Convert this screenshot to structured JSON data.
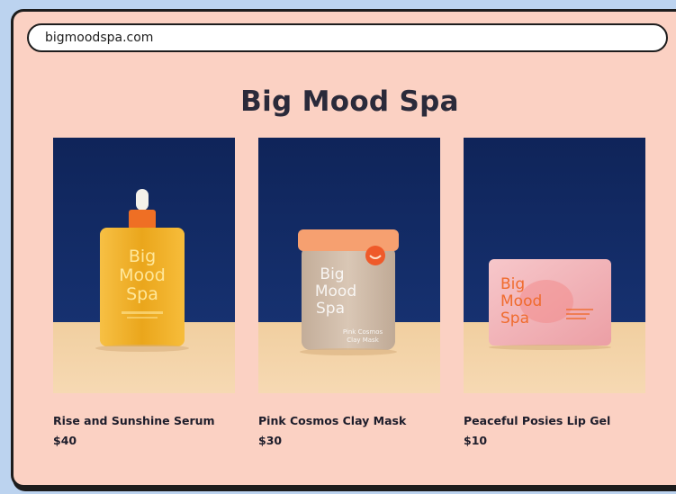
{
  "browser": {
    "url": "bigmoodspa.com"
  },
  "site": {
    "title": "Big Mood Spa"
  },
  "products": [
    {
      "name": "Rise and Sunshine Serum",
      "price": "$40",
      "label_lines": [
        "Big",
        "Mood",
        "Spa"
      ],
      "product_color": "#f0b025",
      "label_color": "#ffe79a",
      "image_icon": "serum-bottle-image"
    },
    {
      "name": "Pink Cosmos Clay Mask",
      "price": "$30",
      "label_lines": [
        "Big",
        "Mood",
        "Spa"
      ],
      "sub_label": [
        "Pink Cosmos",
        "Clay Mask"
      ],
      "product_color": "#cdb8a5",
      "lid_color": "#f6a070",
      "label_color": "#ffffff",
      "image_icon": "clay-mask-jar-image"
    },
    {
      "name": "Peaceful Posies Lip Gel",
      "price": "$10",
      "label_lines": [
        "Big",
        "Mood",
        "Spa"
      ],
      "product_color": "#f2a9ae",
      "label_color": "#f06b2d",
      "image_icon": "lip-gel-packet-image"
    }
  ]
}
